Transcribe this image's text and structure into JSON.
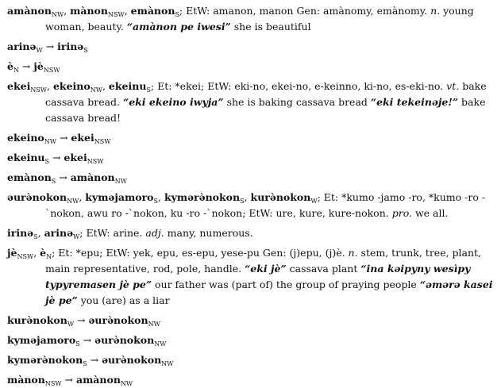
{
  "entries": [
    {
      "parts": [
        {
          "t": "amànon",
          "s": "hw"
        },
        {
          "t": "NW",
          "s": "sub"
        },
        {
          "t": ", "
        },
        {
          "t": "mànon",
          "s": "hw"
        },
        {
          "t": "NSW",
          "s": "sub"
        },
        {
          "t": ", "
        },
        {
          "t": "emànon",
          "s": "hw"
        },
        {
          "t": "S",
          "s": "sub"
        },
        {
          "t": "; EtW: amanon, manon Gen: amànomy, emànomy. "
        },
        {
          "t": "n.",
          "s": "it"
        },
        {
          "t": " young woman, beauty. "
        },
        {
          "t": "“amànon pe iwesi”",
          "s": "bi"
        },
        {
          "t": " she is beautiful"
        }
      ]
    },
    {
      "parts": [
        {
          "t": "arinə",
          "s": "hw"
        },
        {
          "t": "W",
          "s": "sub"
        },
        {
          "t": " → "
        },
        {
          "t": "irinə",
          "s": "hw"
        },
        {
          "t": "S",
          "s": "sub"
        }
      ]
    },
    {
      "parts": [
        {
          "t": "è",
          "s": "hw"
        },
        {
          "t": "N",
          "s": "sub"
        },
        {
          "t": " → "
        },
        {
          "t": "jè",
          "s": "hw"
        },
        {
          "t": "NSW",
          "s": "sub"
        }
      ]
    },
    {
      "parts": [
        {
          "t": "ekei",
          "s": "hw"
        },
        {
          "t": "NSW",
          "s": "sub"
        },
        {
          "t": ", "
        },
        {
          "t": "ekeino",
          "s": "hw"
        },
        {
          "t": "NW",
          "s": "sub"
        },
        {
          "t": ", "
        },
        {
          "t": "ekeinu",
          "s": "hw"
        },
        {
          "t": "S",
          "s": "sub"
        },
        {
          "t": "; Et: *ekei; EtW: eki-no, ekei-no, e-keinno, ki-no, es-eki-no. "
        },
        {
          "t": "vt.",
          "s": "it"
        },
        {
          "t": " bake cassava bread. "
        },
        {
          "t": "“eki ekeino iwyja”",
          "s": "bi"
        },
        {
          "t": " she is baking cassava bread "
        },
        {
          "t": "“eki tekeinəje!”",
          "s": "bi"
        },
        {
          "t": " bake cassava bread!"
        }
      ]
    },
    {
      "parts": [
        {
          "t": "ekeino",
          "s": "hw"
        },
        {
          "t": "NW",
          "s": "sub"
        },
        {
          "t": " → "
        },
        {
          "t": "ekei",
          "s": "hw"
        },
        {
          "t": "NSW",
          "s": "sub"
        }
      ]
    },
    {
      "parts": [
        {
          "t": "ekeinu",
          "s": "hw"
        },
        {
          "t": "S",
          "s": "sub"
        },
        {
          "t": " → "
        },
        {
          "t": "ekei",
          "s": "hw"
        },
        {
          "t": "NSW",
          "s": "sub"
        }
      ]
    },
    {
      "parts": [
        {
          "t": "emànon",
          "s": "hw"
        },
        {
          "t": "S",
          "s": "sub"
        },
        {
          "t": " → "
        },
        {
          "t": "amànon",
          "s": "hw"
        },
        {
          "t": "NW",
          "s": "sub"
        }
      ]
    },
    {
      "parts": [
        {
          "t": "əurə̀nokon",
          "s": "hw"
        },
        {
          "t": "NW",
          "s": "sub"
        },
        {
          "t": ", "
        },
        {
          "t": "kyməjamoro",
          "s": "hw"
        },
        {
          "t": "S",
          "s": "sub"
        },
        {
          "t": ", "
        },
        {
          "t": "kymərə̀nokon",
          "s": "hw"
        },
        {
          "t": "S",
          "s": "sub"
        },
        {
          "t": ", "
        },
        {
          "t": "kurə̀nokon",
          "s": "hw"
        },
        {
          "t": "W",
          "s": "sub"
        },
        {
          "t": "; Et: *kumo -jamo -ro, *kumo -ro -`nokon, awu ro -`nokon, ku -ro -`nokon; EtW: ure, kure, kure-nokon. "
        },
        {
          "t": "pro.",
          "s": "it"
        },
        {
          "t": " we all."
        }
      ]
    },
    {
      "parts": [
        {
          "t": "irinə",
          "s": "hw"
        },
        {
          "t": "S",
          "s": "sub"
        },
        {
          "t": ", "
        },
        {
          "t": "arinə",
          "s": "hw"
        },
        {
          "t": "W",
          "s": "sub"
        },
        {
          "t": "; EtW: arine. "
        },
        {
          "t": "adj.",
          "s": "it"
        },
        {
          "t": " many, numerous."
        }
      ]
    },
    {
      "parts": [
        {
          "t": "jè",
          "s": "hw"
        },
        {
          "t": "NSW",
          "s": "sub"
        },
        {
          "t": ", "
        },
        {
          "t": "è",
          "s": "hw"
        },
        {
          "t": "N",
          "s": "sub"
        },
        {
          "t": "; Et: *epu; EtW: yek, epu, es-epu, yese-pu Gen: (j)epu, (j)è. "
        },
        {
          "t": "n.",
          "s": "it"
        },
        {
          "t": " stem, trunk, tree, plant, main representative, rod, pole, handle. "
        },
        {
          "t": "“eki jè”",
          "s": "bi"
        },
        {
          "t": " cassava plant "
        },
        {
          "t": "“ina kəipyny wesìpy typyremasen jè pe”",
          "s": "bi"
        },
        {
          "t": " our father was (part of) the group of praying people "
        },
        {
          "t": "“əmərə kasei jè pe”",
          "s": "bi"
        },
        {
          "t": " you (are) as a liar"
        }
      ]
    },
    {
      "parts": [
        {
          "t": "kurə̀nokon",
          "s": "hw"
        },
        {
          "t": "W",
          "s": "sub"
        },
        {
          "t": " → "
        },
        {
          "t": "əurə̀nokon",
          "s": "hw"
        },
        {
          "t": "NW",
          "s": "sub"
        }
      ]
    },
    {
      "parts": [
        {
          "t": "kyməjamoro",
          "s": "hw"
        },
        {
          "t": "S",
          "s": "sub"
        },
        {
          "t": " → "
        },
        {
          "t": "əurə̀nokon",
          "s": "hw"
        },
        {
          "t": "NW",
          "s": "sub"
        }
      ]
    },
    {
      "parts": [
        {
          "t": "kymərə̀nokon",
          "s": "hw"
        },
        {
          "t": "S",
          "s": "sub"
        },
        {
          "t": " → "
        },
        {
          "t": "əurə̀nokon",
          "s": "hw"
        },
        {
          "t": "NW",
          "s": "sub"
        }
      ]
    },
    {
      "parts": [
        {
          "t": "mànon",
          "s": "hw"
        },
        {
          "t": "NSW",
          "s": "sub"
        },
        {
          "t": " → "
        },
        {
          "t": "amànon",
          "s": "hw"
        },
        {
          "t": "NW",
          "s": "sub"
        }
      ]
    }
  ]
}
